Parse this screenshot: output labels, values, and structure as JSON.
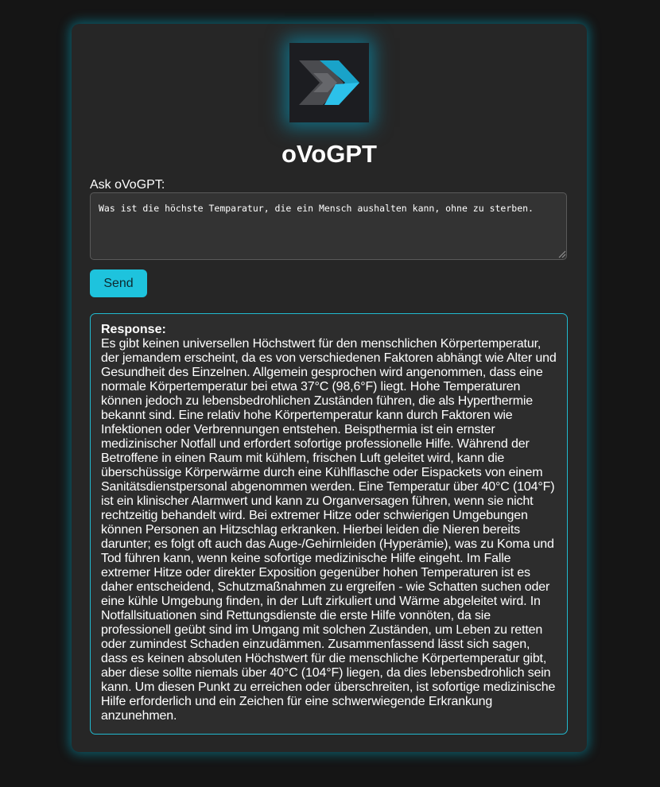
{
  "app": {
    "title": "oVoGPT",
    "logo_icon": "double-chevron-right-icon",
    "accent_color": "#1ec3dd",
    "background_color": "#151515",
    "card_color": "#262626"
  },
  "form": {
    "ask_label": "Ask oVoGPT:",
    "query_value": "Was ist die höchste Temparatur, die ein Mensch aushalten kann, ohne zu sterben.",
    "send_label": "Send"
  },
  "response": {
    "heading": "Response:",
    "text": "Es gibt keinen universellen Höchstwert für den menschlichen Körpertemperatur, der jemandem erscheint, da es von verschiedenen Faktoren abhängt wie Alter und Gesundheit des Einzelnen. Allgemein gesprochen wird angenommen, dass eine normale Körpertemperatur bei etwa 37°C (98,6°F) liegt. Hohe Temperaturen können jedoch zu lebensbedrohlichen Zuständen führen, die als Hyperthermie bekannt sind. Eine relativ hohe Körpertemperatur kann durch Faktoren wie Infektionen oder Verbrennungen entstehen. Beispthermia ist ein ernster medizinischer Notfall und erfordert sofortige professionelle Hilfe. Während der Betroffene in einen Raum mit kühlem, frischen Luft geleitet wird, kann die überschüssige Körperwärme durch eine Kühlflasche oder Eispackets von einem Sanitätsdienstpersonal abgenommen werden. Eine Temperatur über 40°C (104°F) ist ein klinischer Alarmwert und kann zu Organversagen führen, wenn sie nicht rechtzeitig behandelt wird. Bei extremer Hitze oder schwierigen Umgebungen können Personen an Hitzschlag erkranken. Hierbei leiden die Nieren bereits darunter; es folgt oft auch das Auge-/Gehirnleiden (Hyperämie), was zu Koma und Tod führen kann, wenn keine sofortige medizinische Hilfe eingeht. Im Falle extremer Hitze oder direkter Exposition gegenüber hohen Temperaturen ist es daher entscheidend, Schutzmaßnahmen zu ergreifen - wie Schatten suchen oder eine kühle Umgebung finden, in der Luft zirkuliert und Wärme abgeleitet wird. In Notfallsituationen sind Rettungsdienste die erste Hilfe vonnöten, da sie professionell geübt sind im Umgang mit solchen Zuständen, um Leben zu retten oder zumindest Schaden einzudämmen. Zusammenfassend lässt sich sagen, dass es keinen absoluten Höchstwert für die menschliche Körpertemperatur gibt, aber diese sollte niemals über 40°C (104°F) liegen, da dies lebensbedrohlich sein kann. Um diesen Punkt zu erreichen oder überschreiten, ist sofortige medizinische Hilfe erforderlich und ein Zeichen für eine schwerwiegende Erkrankung anzunehmen."
  }
}
